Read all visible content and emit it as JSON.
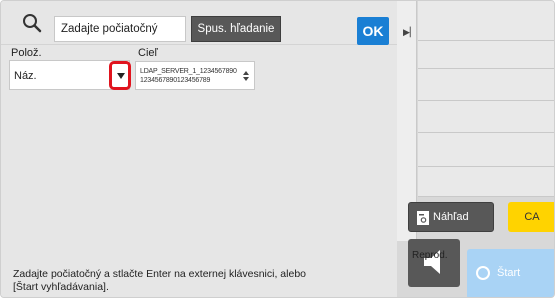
{
  "search": {
    "placeholder": "Zadajte počiatočný",
    "button_label": "Spus. hľadanie"
  },
  "ok_label": "OK",
  "labels": {
    "item": "Polož.",
    "destination": "Cieľ"
  },
  "item_select": {
    "value": "Náz."
  },
  "destination_select": {
    "line1": "LDAP_SERVER_1_1234567890",
    "line2": "1234567890123456789"
  },
  "hint": "Zadajte počiatočný a stlačte Enter na externej klávesnici, alebo [Štart vyhľadávania].",
  "right_panel": {
    "preview_label": "Náhľad",
    "ca_label": "CA",
    "speaker_label": "Reprod.",
    "start_label": "Štart"
  },
  "colors": {
    "ok_blue": "#1a7fd4",
    "ca_yellow": "#ffd300",
    "highlight_red": "#e0141e",
    "start_disabled": "#a9d3f5"
  },
  "icons": {
    "search": "search-icon",
    "dropdown": "chevron-down-icon",
    "collapse": "collapse-icon",
    "preview": "preview-icon",
    "speaker": "speaker-icon",
    "start": "start-icon"
  }
}
